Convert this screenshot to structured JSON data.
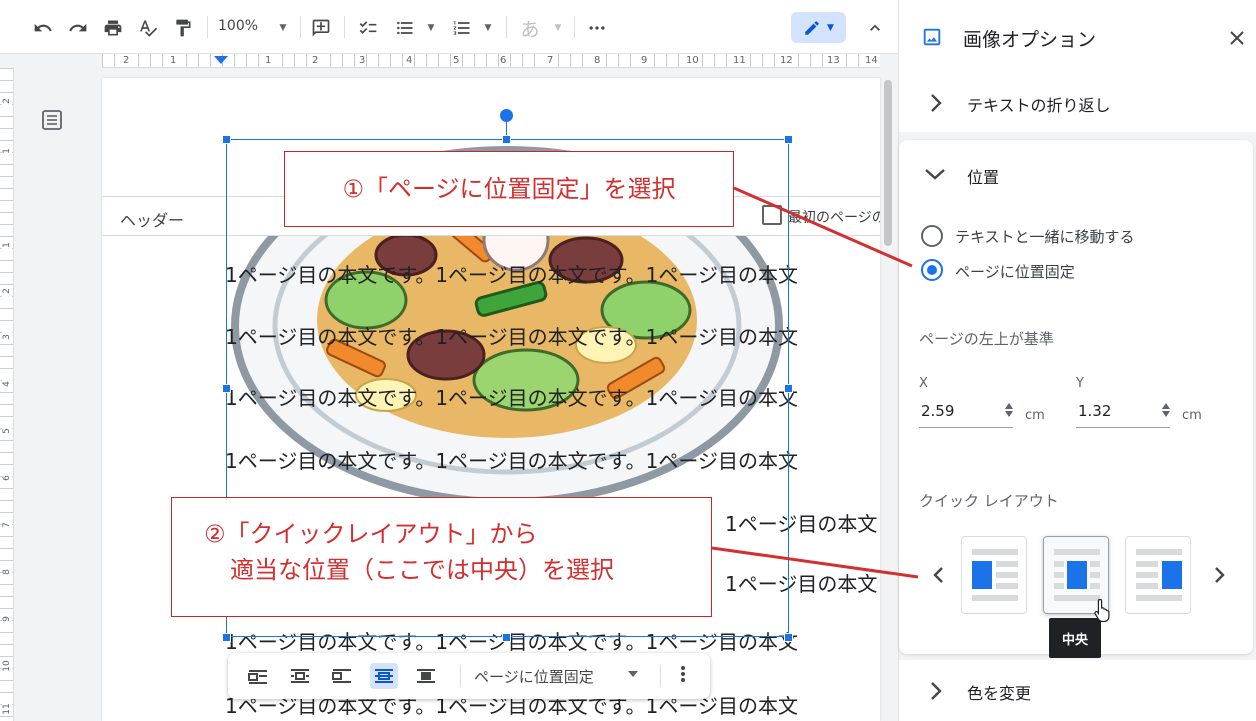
{
  "toolbar": {
    "zoom": "100%",
    "input_mode_char": "あ"
  },
  "ruler": {
    "h_numbers": [
      "2",
      "1",
      "1",
      "2",
      "3",
      "4",
      "5",
      "6",
      "7",
      "8",
      "9",
      "10",
      "11",
      "12",
      "13",
      "14"
    ],
    "v_numbers": [
      "2",
      "1",
      "1",
      "2",
      "3",
      "4",
      "5",
      "6",
      "7",
      "8",
      "9",
      "10",
      "11"
    ]
  },
  "document": {
    "header_label": "ヘッダー",
    "first_page_label": "最初のページの",
    "body_line": "1ページ目の本文です。1ページ目の本文です。1ページ目の本文",
    "partial_line": "1ページ目の本文"
  },
  "image_toolbar": {
    "position_label": "ページに位置固定"
  },
  "panel": {
    "title": "画像オプション",
    "sections": {
      "wrap": "テキストの折り返し",
      "position": "位置",
      "recolor": "色を変更"
    },
    "radios": [
      {
        "label": "テキストと一緒に移動する",
        "checked": false
      },
      {
        "label": "ページに位置固定",
        "checked": true
      }
    ],
    "reference_label": "ページの左上が基準",
    "x_label": "X",
    "x_value": "2.59",
    "y_label": "Y",
    "y_value": "1.32",
    "unit": "cm",
    "quick_layout_label": "クイック レイアウト",
    "tooltip": "中央"
  },
  "annotations": {
    "step1": "①「ページに位置固定」を選択",
    "step2_line1": "②「クイックレイアウト」から",
    "step2_line2": "適当な位置（ここでは中央）を選択"
  },
  "colors": {
    "accent": "#1a73e8",
    "annotation_red": "#d32f2f"
  }
}
